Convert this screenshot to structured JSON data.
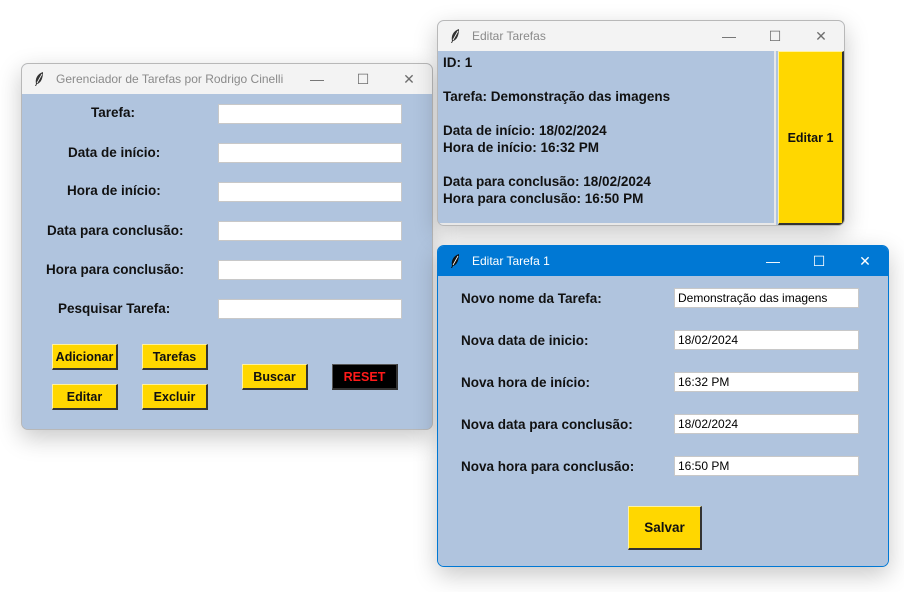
{
  "main_window": {
    "title": "Gerenciador de Tarefas por Rodrigo Cinelli",
    "labels": {
      "tarefa": "Tarefa:",
      "data_inicio": "Data de início:",
      "hora_inicio": "Hora de início:",
      "data_conclusao": "Data para conclusão:",
      "hora_conclusao": "Hora para conclusão:",
      "pesquisar": "Pesquisar Tarefa:"
    },
    "buttons": {
      "adicionar": "Adicionar",
      "tarefas": "Tarefas",
      "editar": "Editar",
      "excluir": "Excluir",
      "buscar": "Buscar",
      "reset": "RESET"
    }
  },
  "editar_tarefas_window": {
    "title": "Editar Tarefas",
    "lines": {
      "id": "ID: 1",
      "tarefa": "Tarefa: Demonstração das imagens",
      "data_inicio": "Data de início: 18/02/2024",
      "hora_inicio": "Hora de início: 16:32 PM",
      "data_conclusao": "Data para conclusão: 18/02/2024",
      "hora_conclusao": "Hora para conclusão: 16:50 PM"
    },
    "edit_button": "Editar 1"
  },
  "editar_tarefa1_window": {
    "title": "Editar Tarefa 1",
    "labels": {
      "nome": "Novo nome da Tarefa:",
      "data_inicio": "Nova data de inicio:",
      "hora_inicio": "Nova hora de início:",
      "data_conclusao": "Nova data para conclusão:",
      "hora_conclusao": "Nova hora para conclusão:"
    },
    "values": {
      "nome": "Demonstração das imagens",
      "data_inicio": "18/02/2024",
      "hora_inicio": "16:32 PM",
      "data_conclusao": "18/02/2024",
      "hora_conclusao": "16:50 PM"
    },
    "save_button": "Salvar"
  },
  "titlebar_glyphs": {
    "minimize": "—",
    "maximize": "☐",
    "close": "✕"
  },
  "colors": {
    "window_bg": "#b0c4de",
    "button_yellow": "#ffd700",
    "reset_bg": "#000000",
    "reset_text": "#ff1a1a",
    "active_titlebar": "#0078d4"
  }
}
